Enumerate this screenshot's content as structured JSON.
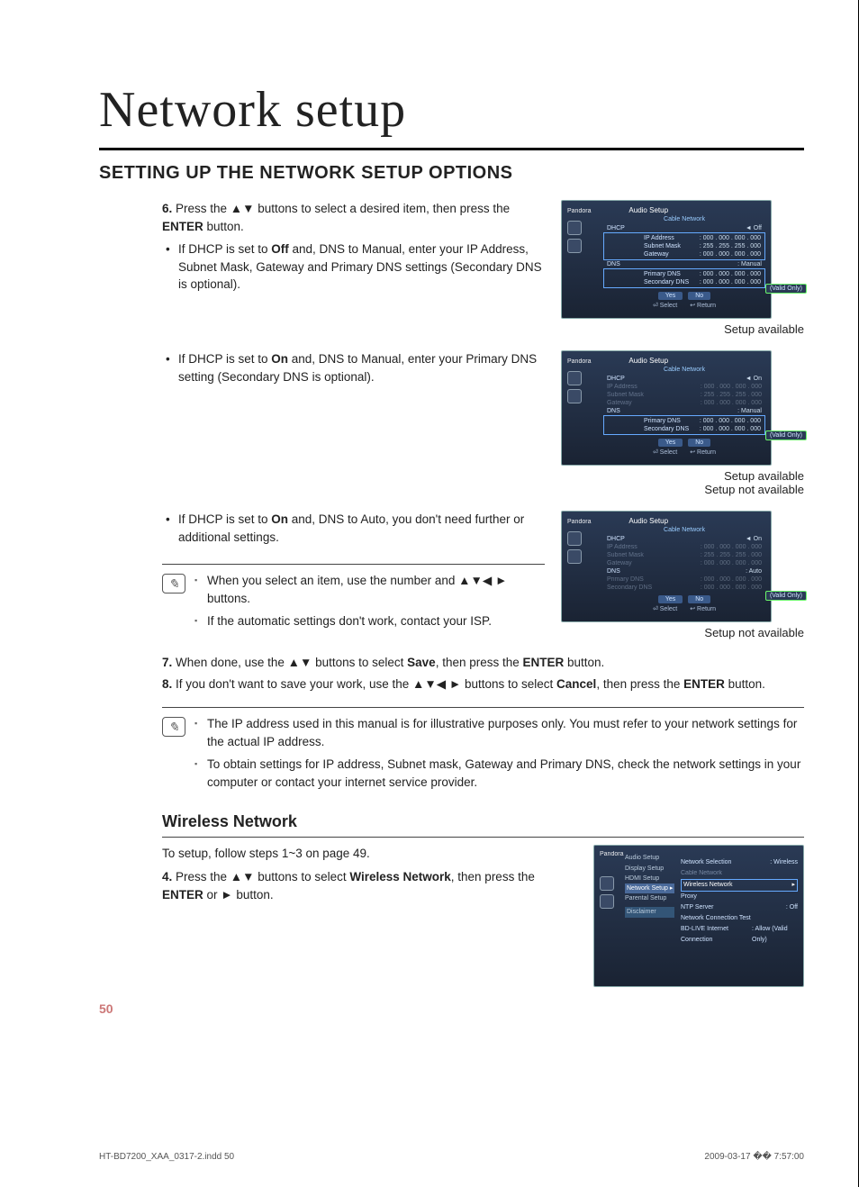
{
  "chapter_title": "Network setup",
  "section_title": "SETTING UP THE NETWORK SETUP OPTIONS",
  "step6": {
    "num": "6.",
    "text_a": "Press the ▲▼ buttons to select a desired item, then press the ",
    "enter": "ENTER",
    "text_b": " button.",
    "bullet1_a": "If DHCP is set to ",
    "bullet1_off": "Off",
    "bullet1_b": " and, DNS to Manual, enter your IP Address, Subnet Mask, Gateway and Primary DNS settings (Secondary DNS is optional).",
    "bullet2_a": "If DHCP is set to ",
    "bullet2_on": "On",
    "bullet2_b": " and, DNS to Manual, enter your Primary DNS setting (Secondary DNS is optional).",
    "bullet3_a": "If DHCP is set to ",
    "bullet3_on": "On",
    "bullet3_b": " and, DNS to Auto, you don't need further or additional settings."
  },
  "note1": {
    "a": "When you select an item, use the number and ▲▼◀ ► buttons.",
    "b": "If the automatic settings don't work, contact your ISP."
  },
  "step7_a": "When done, use the ▲▼ buttons to select ",
  "step7_save": "Save",
  "step7_b": ", then press the ",
  "step7_enter": "ENTER",
  "step7_c": " button.",
  "step7_num": "7.",
  "step8_num": "8.",
  "step8_a": "If you don't want to save your work, use the ▲▼◀ ► buttons to select ",
  "step8_cancel": "Cancel",
  "step8_b": ", then press the ",
  "step8_enter": "ENTER",
  "step8_c": " button.",
  "note2": {
    "a": "The IP address used in this manual is for illustrative purposes only. You must refer to your network settings for the actual IP address.",
    "b": "To obtain settings for IP address, Subnet mask, Gateway and Primary DNS, check the network settings in your computer or contact your internet service provider."
  },
  "wireless_heading": "Wireless Network",
  "wireless_intro": "To setup, follow steps 1~3 on page 49.",
  "step4_num": "4.",
  "step4_a": "Press the ▲▼ buttons to select ",
  "step4_wn": "Wireless Network",
  "step4_b": ", then press the ",
  "step4_enter": "ENTER",
  "step4_c": " or ► button.",
  "captions": {
    "avail": "Setup available",
    "notavail": "Setup not available"
  },
  "tv": {
    "brand": "Pandora",
    "title": "Audio Setup",
    "subtitle": "Cable Network",
    "dhcp": "DHCP",
    "off": "◄ Off",
    "on": "◄ On",
    "ip": "IP Address",
    "ipval": ": 000 . 000 . 000 . 000",
    "mask": "Subnet Mask",
    "maskval": ": 255 . 255 . 255 . 000",
    "gw": "Gateway",
    "gwval": ": 000 . 000 . 000 . 000",
    "dns": "DNS",
    "manual": ": Manual",
    "auto": ": Auto",
    "pdns": "Primary DNS",
    "pdnsval": ": 000 . 000 . 000 . 000",
    "sdns": "Secondary DNS",
    "sdnsval": ": 000 . 000 . 000 . 000",
    "yes": "Yes",
    "no": "No",
    "select": "⏎ Select",
    "return": "↩ Return",
    "tag": "(Valid Only)"
  },
  "wireless_tv": {
    "m1": "Audio Setup",
    "m2": "Display Setup",
    "m3": "HDMI Setup",
    "m4": "Network Setup  ▸",
    "m5": "Parental Setup",
    "r1k": "Network Selection",
    "r1v": ": Wireless",
    "r2": "Cable Network",
    "r3": "Wireless Network",
    "r3v": "▸",
    "r4": "Proxy",
    "r5k": "NTP Server",
    "r5v": ": Off",
    "r6": "Network Connection Test",
    "r7k": "BD-LIVE Internet Connection",
    "r7v": ": Allow (Valid Only)",
    "disclaimer": "Disclaimer"
  },
  "page_num": "50",
  "footer_left": "HT-BD7200_XAA_0317-2.indd   50",
  "footer_right": "2009-03-17   �� 7:57:00"
}
